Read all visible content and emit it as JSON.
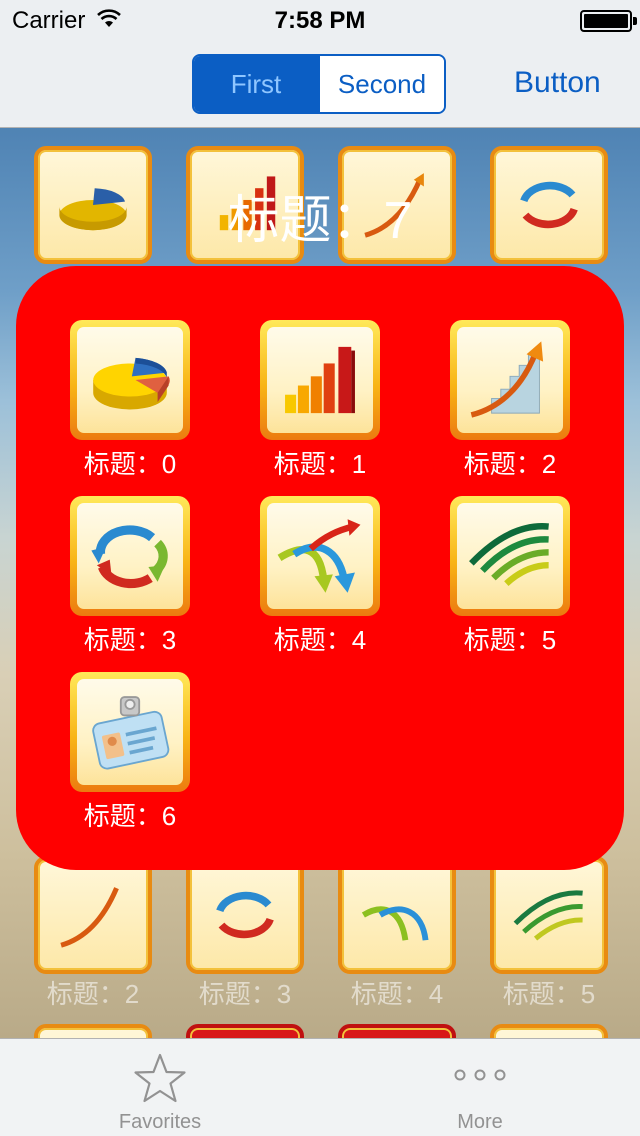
{
  "status_bar": {
    "carrier": "Carrier",
    "time": "7:58 PM"
  },
  "nav": {
    "segments": [
      {
        "label": "First",
        "selected": true
      },
      {
        "label": "Second",
        "selected": false
      }
    ],
    "right_button": "Button"
  },
  "overlay_title": "标题：7",
  "panel": {
    "color": "#ff0000",
    "items": [
      {
        "label": "标题：0",
        "icon": "pie-chart-icon"
      },
      {
        "label": "标题：1",
        "icon": "bar-chart-icon"
      },
      {
        "label": "标题：2",
        "icon": "growth-chart-icon"
      },
      {
        "label": "标题：3",
        "icon": "cycle-arrows-icon"
      },
      {
        "label": "标题：4",
        "icon": "branch-arrows-icon"
      },
      {
        "label": "标题：5",
        "icon": "signal-arcs-icon"
      },
      {
        "label": "标题：6",
        "icon": "id-badge-icon"
      }
    ]
  },
  "background_grid": {
    "labels": [
      "标题：2",
      "标题：3",
      "标题：4",
      "标题：5"
    ]
  },
  "tab_bar": {
    "tabs": [
      {
        "label": "Favorites",
        "icon": "star-icon"
      },
      {
        "label": "More",
        "icon": "more-icon"
      }
    ]
  },
  "colors": {
    "accent": "#0b5ec4",
    "tile_border": "#ec7a10"
  }
}
